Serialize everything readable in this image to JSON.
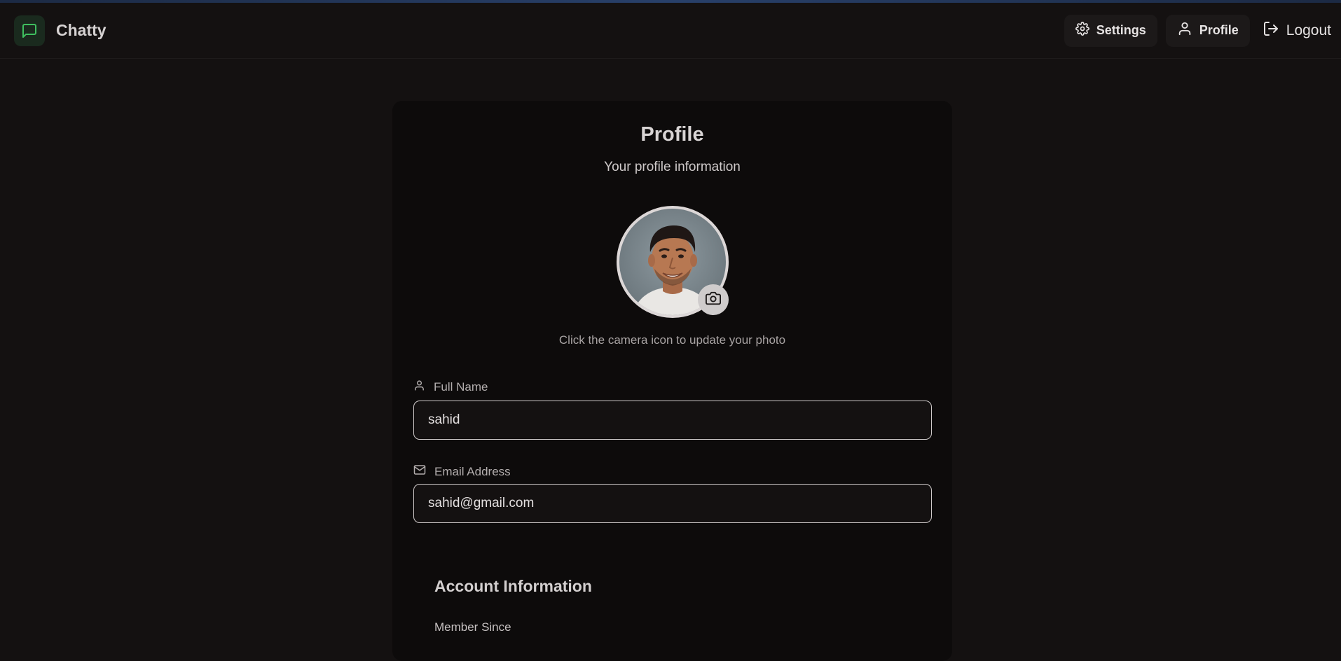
{
  "app": {
    "name": "Chatty"
  },
  "nav": {
    "settings": "Settings",
    "profile": "Profile",
    "logout": "Logout"
  },
  "profile": {
    "title": "Profile",
    "subtitle": "Your profile information",
    "photo_hint": "Click the camera icon to update your photo",
    "full_name": {
      "label": "Full Name",
      "value": "sahid"
    },
    "email": {
      "label": "Email Address",
      "value": "sahid@gmail.com"
    }
  },
  "account": {
    "title": "Account Information",
    "member_since_label": "Member Since"
  },
  "icons": {
    "brand": "message-square-icon",
    "settings": "gear-icon",
    "profile": "user-icon",
    "logout": "logout-icon",
    "camera": "camera-icon",
    "name_field": "user-icon",
    "email_field": "mail-icon"
  },
  "colors": {
    "background": "#141111",
    "card": "#0d0b0b",
    "brand_accent": "#3fbf5f"
  }
}
